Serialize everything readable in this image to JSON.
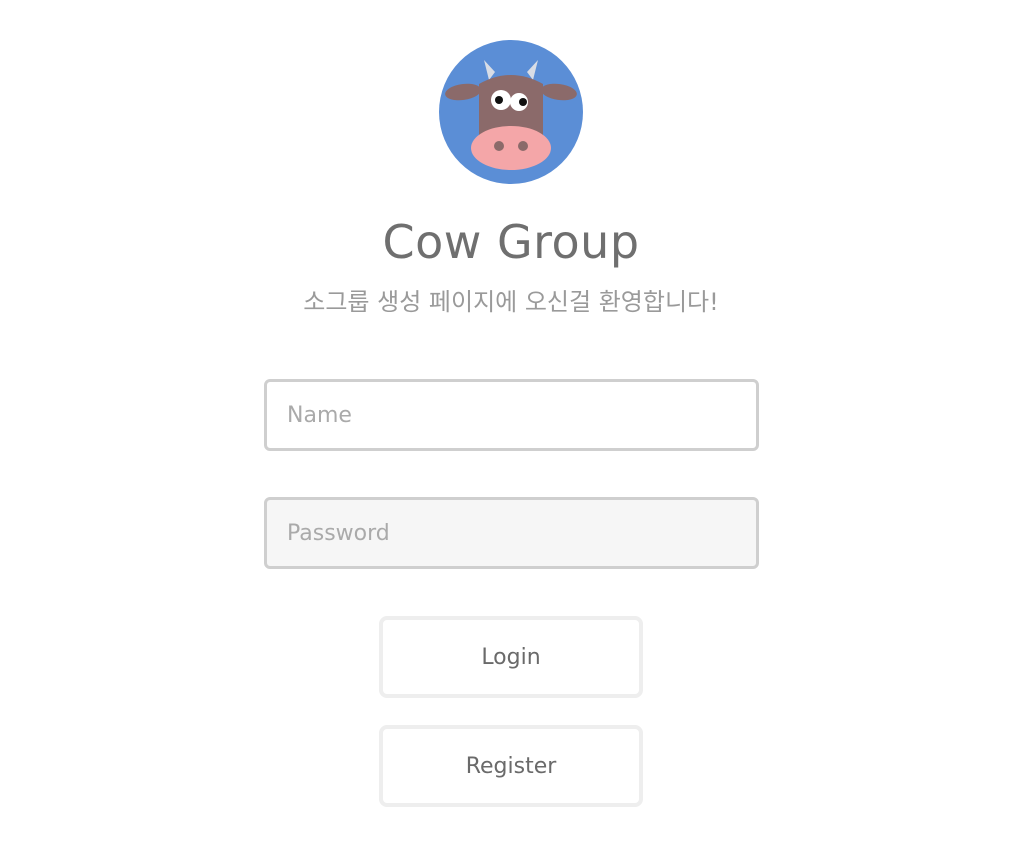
{
  "brand": {
    "logo_icon": "cow-face-icon",
    "title": "Cow Group",
    "welcome_message": "소그룹 생성 페이지에 오신걸 환영합니다!"
  },
  "form": {
    "name_placeholder": "Name",
    "name_value": "",
    "password_placeholder": "Password",
    "password_value": ""
  },
  "actions": {
    "login_label": "Login",
    "register_label": "Register"
  },
  "colors": {
    "logo_background": "#5b8ed6",
    "cow_face": "#8b6a6a",
    "cow_snout": "#f4a6a8",
    "title_text": "#6f6f6f",
    "subtitle_text": "#9a9a9a",
    "input_border": "#cfcfcf",
    "button_border": "#eeeeee"
  }
}
